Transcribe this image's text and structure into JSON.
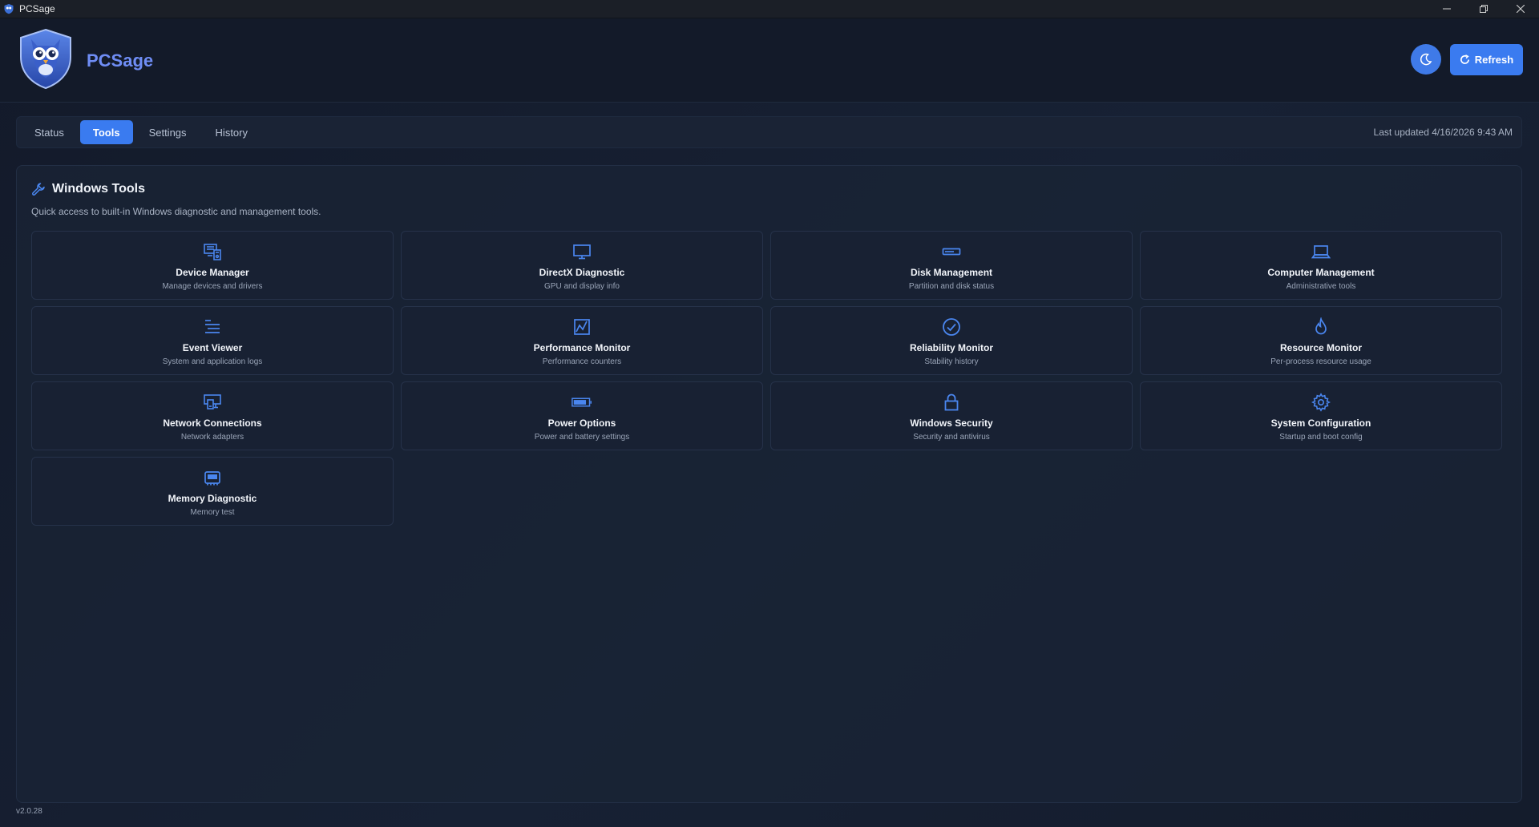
{
  "window": {
    "title": "PCSage"
  },
  "header": {
    "brand": "PCSage",
    "refresh_label": "Refresh"
  },
  "tabs": [
    {
      "label": "Status",
      "active": false
    },
    {
      "label": "Tools",
      "active": true
    },
    {
      "label": "Settings",
      "active": false
    },
    {
      "label": "History",
      "active": false
    }
  ],
  "last_updated": "Last updated 4/16/2026 9:43 AM",
  "panel": {
    "title": "Windows Tools",
    "subtitle": "Quick access to built-in Windows diagnostic and management tools."
  },
  "tools": [
    {
      "name": "Device Manager",
      "desc": "Manage devices and drivers",
      "icon": "device-manager-icon"
    },
    {
      "name": "DirectX Diagnostic",
      "desc": "GPU and display info",
      "icon": "monitor-icon"
    },
    {
      "name": "Disk Management",
      "desc": "Partition and disk status",
      "icon": "disk-icon"
    },
    {
      "name": "Computer Management",
      "desc": "Administrative tools",
      "icon": "laptop-icon"
    },
    {
      "name": "Event Viewer",
      "desc": "System and application logs",
      "icon": "list-icon"
    },
    {
      "name": "Performance Monitor",
      "desc": "Performance counters",
      "icon": "chart-icon"
    },
    {
      "name": "Reliability Monitor",
      "desc": "Stability history",
      "icon": "check-circle-icon"
    },
    {
      "name": "Resource Monitor",
      "desc": "Per-process resource usage",
      "icon": "flame-icon"
    },
    {
      "name": "Network Connections",
      "desc": "Network adapters",
      "icon": "network-icon"
    },
    {
      "name": "Power Options",
      "desc": "Power and battery settings",
      "icon": "battery-icon"
    },
    {
      "name": "Windows Security",
      "desc": "Security and antivirus",
      "icon": "lock-icon"
    },
    {
      "name": "System Configuration",
      "desc": "Startup and boot config",
      "icon": "gear-icon"
    },
    {
      "name": "Memory Diagnostic",
      "desc": "Memory test",
      "icon": "memory-icon"
    }
  ],
  "version": "v2.0.28",
  "colors": {
    "accent": "#3a7bf0",
    "icon": "#4a86ef",
    "background": "#141c2c"
  }
}
